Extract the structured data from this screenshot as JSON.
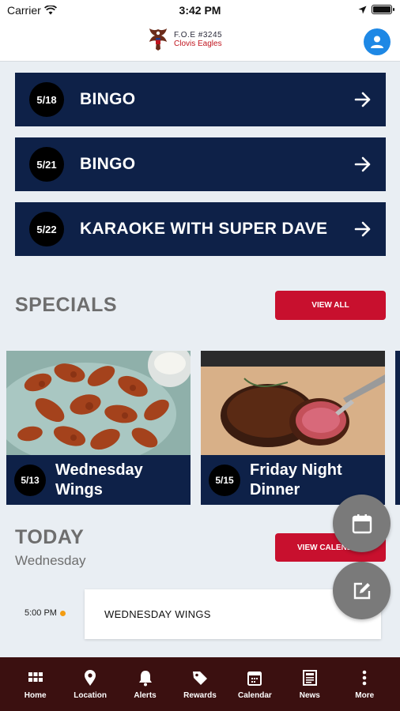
{
  "status_bar": {
    "carrier": "Carrier",
    "time": "3:42 PM"
  },
  "header": {
    "line1": "F.O.E #3245",
    "line2": "Clovis Eagles"
  },
  "events": [
    {
      "date": "5/18",
      "title": "BINGO"
    },
    {
      "date": "5/21",
      "title": "BINGO"
    },
    {
      "date": "5/22",
      "title": "KARAOKE WITH SUPER DAVE"
    }
  ],
  "specials": {
    "title": "SPECIALS",
    "view_all": "VIEW ALL",
    "cards": [
      {
        "date": "5/13",
        "title_line1": "Wednesday",
        "title_line2": "Wings"
      },
      {
        "date": "5/15",
        "title_line1": "Friday Night",
        "title_line2": "Dinner"
      }
    ]
  },
  "today": {
    "title": "TODAY",
    "day": "Wednesday",
    "view_calendar": "VIEW CALENDAR",
    "items": [
      {
        "time": "5:00 PM",
        "title": "WEDNESDAY WINGS"
      }
    ]
  },
  "tabs": [
    "Home",
    "Location",
    "Alerts",
    "Rewards",
    "Calendar",
    "News",
    "More"
  ],
  "colors": {
    "navy": "#0e2148",
    "red": "#c8102e",
    "tabbar": "#3b1010",
    "accent_blue": "#1e88e5"
  }
}
